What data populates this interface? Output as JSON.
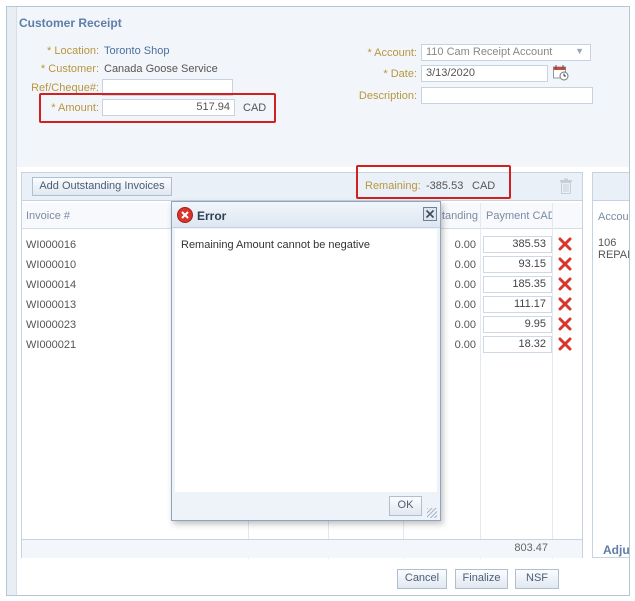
{
  "window": {
    "title": "Customer Receipt"
  },
  "form": {
    "location": {
      "label": "* Location:",
      "value": "Toronto Shop"
    },
    "customer": {
      "label": "* Customer:",
      "value": "Canada Goose Service"
    },
    "ref": {
      "label": "Ref/Cheque#:",
      "value": ""
    },
    "amount": {
      "label": "* Amount:",
      "value": "517.94",
      "currency": "CAD"
    },
    "account": {
      "label": "* Account:",
      "value": "110 Cam Receipt Account"
    },
    "date": {
      "label": "* Date:",
      "value": "3/13/2020"
    },
    "description": {
      "label": "Description:",
      "value": ""
    }
  },
  "invoices": {
    "add_button": "Add Outstanding Invoices",
    "remaining": {
      "label": "Remaining:",
      "value": "-385.53",
      "currency": "CAD"
    },
    "columns": {
      "invoice": "Invoice #",
      "outstanding": "tanding",
      "payment": "Payment CAD"
    },
    "rows": [
      {
        "invoice": "WI000016",
        "outstanding": "0.00",
        "payment": "385.53"
      },
      {
        "invoice": "WI000010",
        "outstanding": "0.00",
        "payment": "93.15"
      },
      {
        "invoice": "WI000014",
        "outstanding": "0.00",
        "payment": "185.35"
      },
      {
        "invoice": "WI000013",
        "outstanding": "0.00",
        "payment": "111.17"
      },
      {
        "invoice": "WI000023",
        "outstanding": "0.00",
        "payment": "9.95"
      },
      {
        "invoice": "WI000021",
        "outstanding": "0.00",
        "payment": "18.32"
      }
    ],
    "total": "803.47"
  },
  "right_panel": {
    "column": "Accou",
    "line1": "106",
    "line2": "REPAI",
    "tab": "Adju"
  },
  "buttons": {
    "cancel": "Cancel",
    "finalize": "Finalize",
    "nsf": "NSF"
  },
  "dialog": {
    "title": "Error",
    "message": "Remaining Amount cannot be negative",
    "ok": "OK"
  },
  "colors": {
    "error_red": "#d12020",
    "label_gold": "#b8963f",
    "link_blue": "#4a6f9c"
  }
}
